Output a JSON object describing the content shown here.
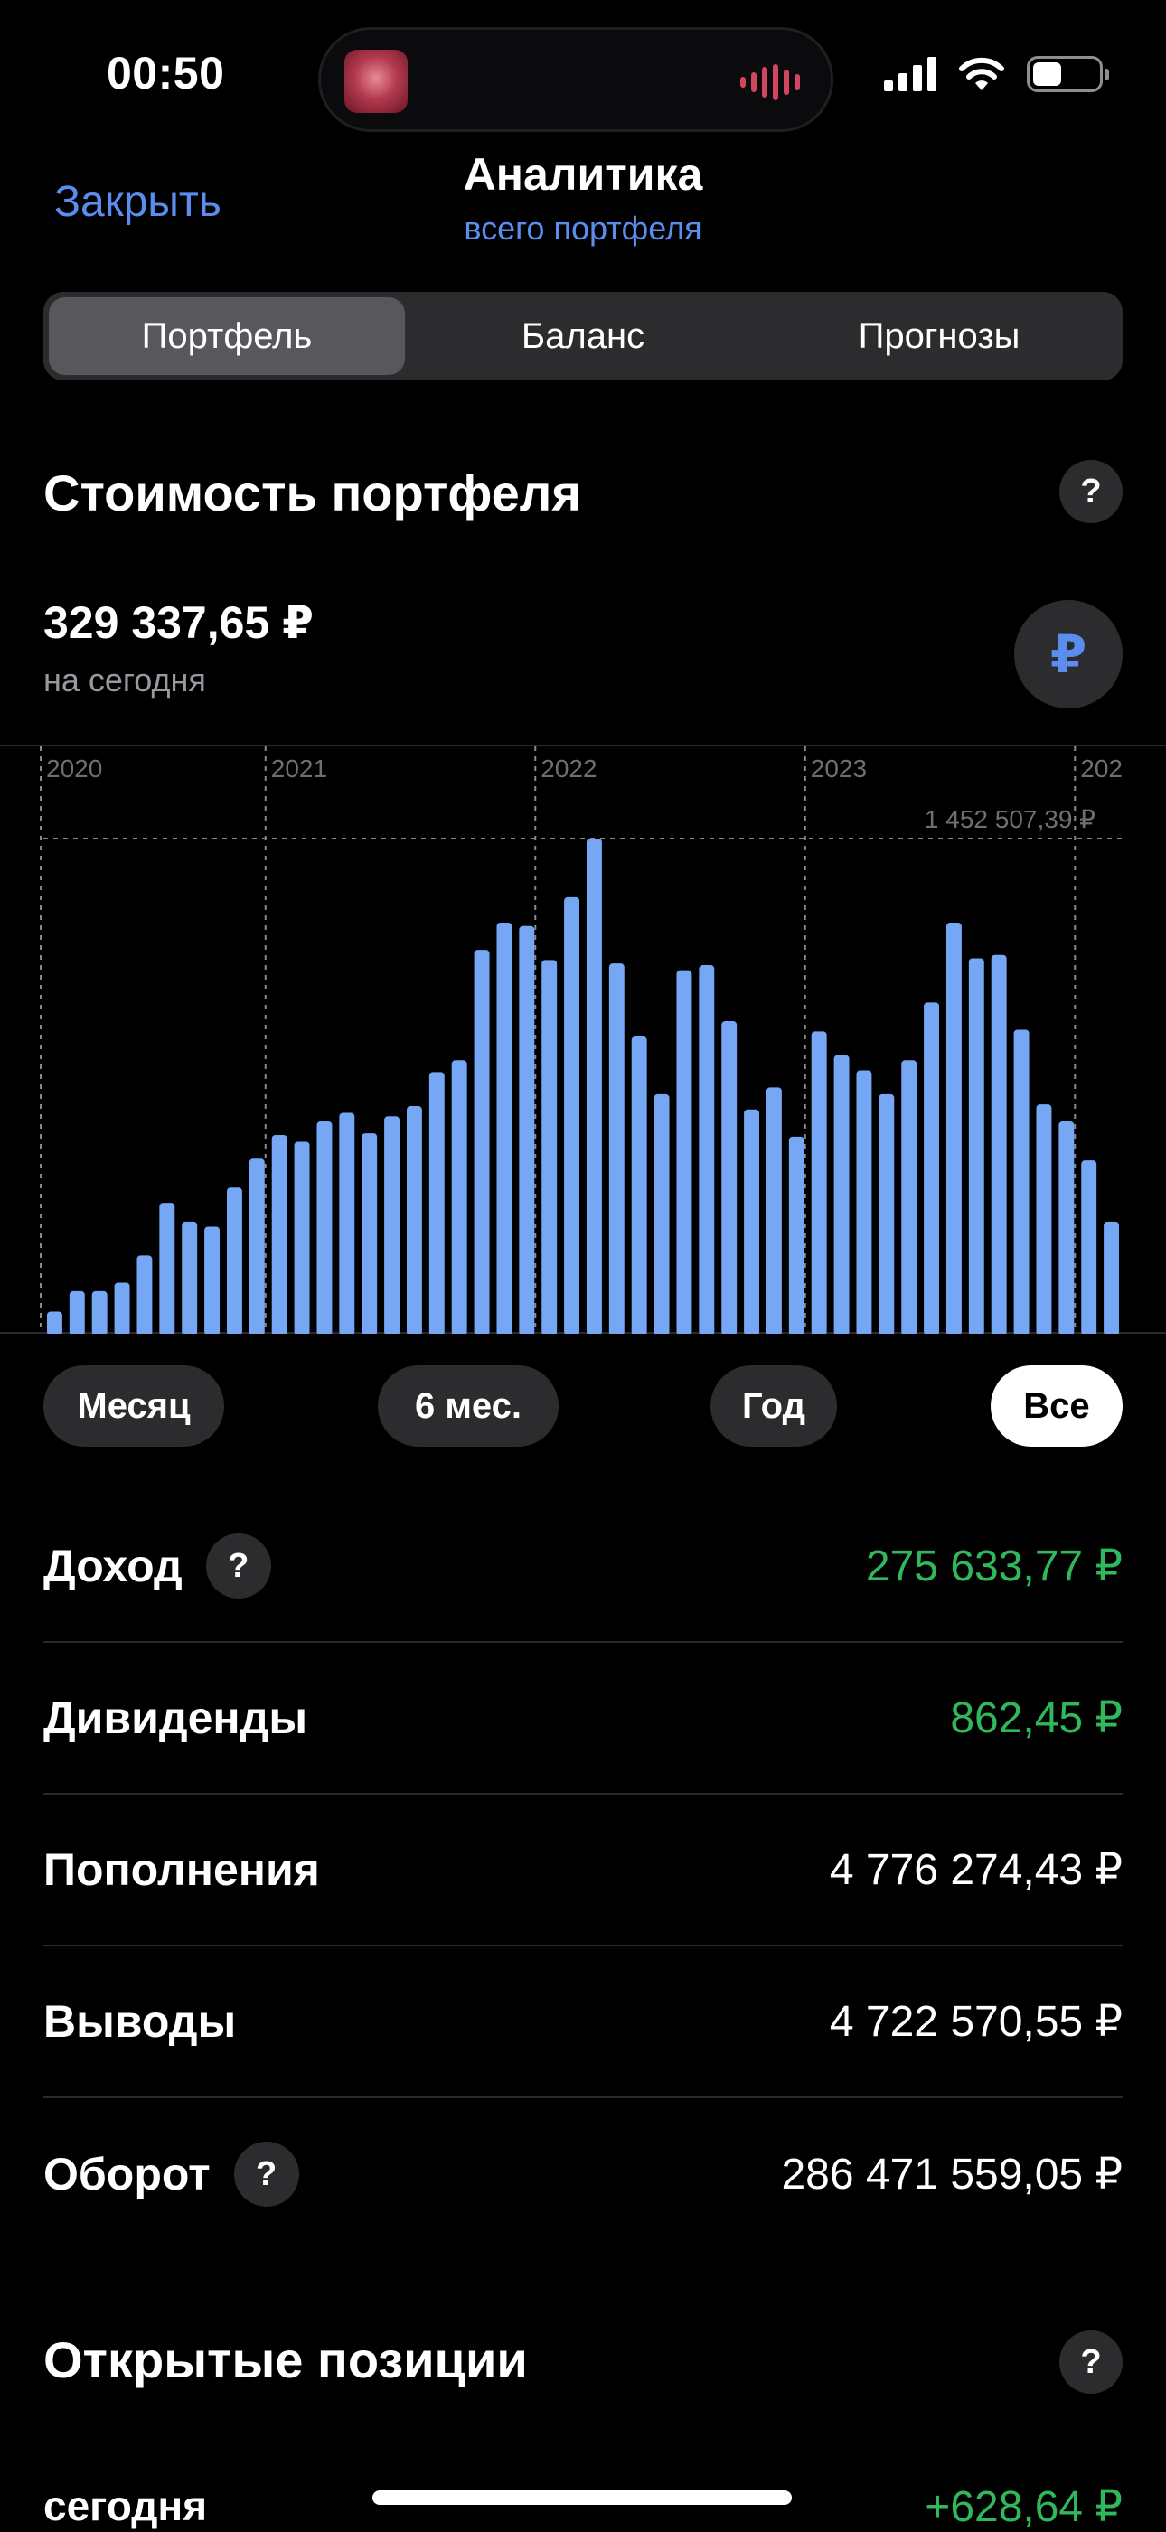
{
  "status": {
    "time": "00:50",
    "battery_level": 0.45,
    "icons": [
      "now-playing-artwork",
      "audio-waveform-icon",
      "cellular-signal-icon",
      "wifi-icon",
      "battery-icon"
    ]
  },
  "nav": {
    "close": "Закрыть",
    "title": "Аналитика",
    "subtitle": "всего портфеля"
  },
  "tabs": [
    {
      "label": "Портфель",
      "active": true
    },
    {
      "label": "Баланс",
      "active": false
    },
    {
      "label": "Прогнозы",
      "active": false
    }
  ],
  "portfolio": {
    "title": "Стоимость портфеля",
    "help": "?",
    "value": "329 337,65 ₽",
    "value_caption": "на сегодня",
    "currency_symbol": "₽"
  },
  "chart_data": {
    "type": "bar",
    "color": "#76a7f5",
    "x_labels": [
      "2020",
      "2021",
      "2022",
      "2023",
      "202"
    ],
    "max_label": "1 452 507,39 ₽",
    "max_value": 1452507.39,
    "values": [
      60000,
      120000,
      120000,
      145000,
      225000,
      380000,
      325000,
      310000,
      425000,
      510000,
      580000,
      560000,
      620000,
      645000,
      585000,
      635000,
      665000,
      765000,
      800000,
      1125000,
      1205000,
      1195000,
      1095000,
      1280000,
      1452507,
      1085000,
      870000,
      700000,
      1065000,
      1080000,
      915000,
      655000,
      720000,
      575000,
      885000,
      815000,
      770000,
      700000,
      800000,
      970000,
      1205000,
      1100000,
      1110000,
      890000,
      670000,
      620000,
      505000,
      325000
    ],
    "ylim": [
      0,
      1452507.39
    ],
    "grid": "vertical dashed at year boundaries, horizontal dashed at max"
  },
  "ranges": [
    {
      "label": "Месяц",
      "active": false
    },
    {
      "label": "6 мес.",
      "active": false
    },
    {
      "label": "Год",
      "active": false
    },
    {
      "label": "Все",
      "active": true
    }
  ],
  "stats": [
    {
      "label": "Доход",
      "help": true,
      "value": "275 633,77 ₽",
      "color": "#30b85c"
    },
    {
      "label": "Дивиденды",
      "help": false,
      "value": "862,45 ₽",
      "color": "#30b85c"
    },
    {
      "label": "Пополнения",
      "help": false,
      "value": "4 776 274,43 ₽",
      "color": "#ffffff"
    },
    {
      "label": "Выводы",
      "help": false,
      "value": "4 722 570,55 ₽",
      "color": "#ffffff"
    },
    {
      "label": "Оборот",
      "help": true,
      "value": "286 471 559,05 ₽",
      "color": "#ffffff"
    }
  ],
  "open_positions": {
    "title": "Открытые позиции",
    "help": "?",
    "row_label": "сегодня",
    "row_value": "+628,64 ₽"
  }
}
